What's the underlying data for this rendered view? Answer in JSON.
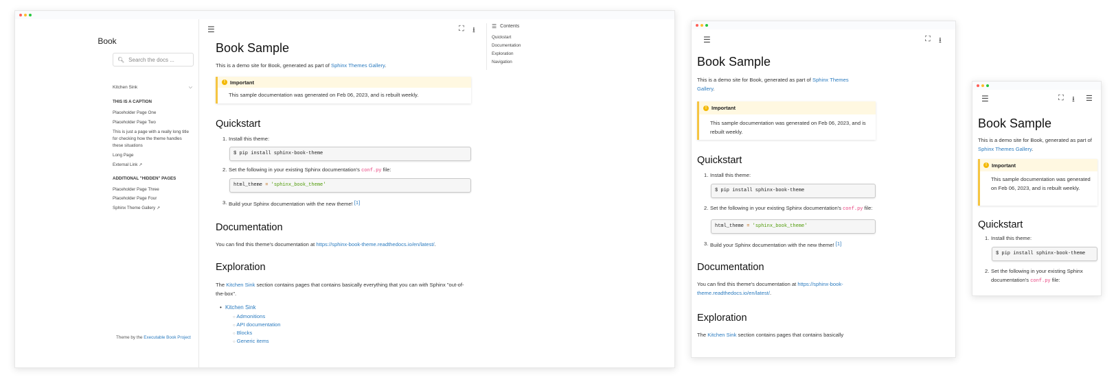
{
  "colors": {
    "dot_red": "#ff5f57",
    "dot_yellow": "#febc2e",
    "dot_green": "#28c840",
    "link": "#2b7bbf",
    "admonition": "#f5c542",
    "code_inline": "#e8417e",
    "string": "#4e9a06"
  },
  "icons": {
    "menu": "hamburger-icon",
    "fullscreen": "fullscreen-icon",
    "download": "download-icon",
    "toc": "list-icon",
    "search": "search-icon",
    "chevron": "chevron-down-icon",
    "external": "external-link-icon",
    "important": "exclamation-icon"
  },
  "sidebar": {
    "title": "Book",
    "search_placeholder": "Search the docs ...",
    "dropdown_label": "Kitchen Sink",
    "caption1": "THIS IS A CAPTION",
    "items1": [
      "Placeholder Page One",
      "Placeholder Page Two",
      "This is just a page with a really long title for checking how the theme handles these situations",
      "Long Page",
      "External Link"
    ],
    "caption2": "ADDITIONAL \"HIDDEN\" PAGES",
    "items2": [
      "Placeholder Page Three",
      "Placeholder Page Four",
      "Sphinx Theme Gallery"
    ],
    "footer_prefix": "Theme by the ",
    "footer_link": "Executable Book Project"
  },
  "toc": {
    "title": "Contents",
    "items": [
      "Quickstart",
      "Documentation",
      "Exploration",
      "Navigation"
    ]
  },
  "article": {
    "title": "Book Sample",
    "intro_prefix": "This is a demo site for Book, generated as part of ",
    "intro_link": "Sphinx Themes Gallery",
    "intro_link_line1": "Sphinx Themes",
    "intro_link_line2": "Gallery",
    "intro_suffix": ".",
    "admonition_title": "Important",
    "admonition_text": "This sample documentation was generated on Feb 06, 2023, and is rebuilt weekly.",
    "quickstart_heading": "Quickstart",
    "step1": "Install this theme:",
    "step1_code": "$ pip install sphinx-book-theme",
    "step2_prefix": "Set the following in your existing Sphinx documentation's ",
    "step2_code": "conf.py",
    "step2_suffix": " file:",
    "step2_code_var": "html_theme",
    "step2_code_eq": " = ",
    "step2_code_val": "'sphinx_book_theme'",
    "step3_text": "Build your Sphinx documentation with the new theme! ",
    "step3_ref": "[1]",
    "documentation_heading": "Documentation",
    "doc_prefix": "You can find this theme's documentation at ",
    "doc_link": "https://sphinx-book-theme.readthedocs.io/en/latest/",
    "doc_link_line1": "https://sphinx-book-",
    "doc_link_line2": "theme.readthedocs.io/en/latest/",
    "doc_suffix": ".",
    "exploration_heading": "Exploration",
    "expl_prefix": "The ",
    "expl_link": "Kitchen Sink",
    "expl_suffix": " section contains pages that contains basically everything that you can with Sphinx \"out-of-the-box\".",
    "expl_suffix_mid": " section contains pages that contains basically",
    "bullet_main": "Kitchen Sink",
    "sub_items": [
      "Admonitions",
      "API documentation",
      "Blocks",
      "Generic items"
    ]
  }
}
